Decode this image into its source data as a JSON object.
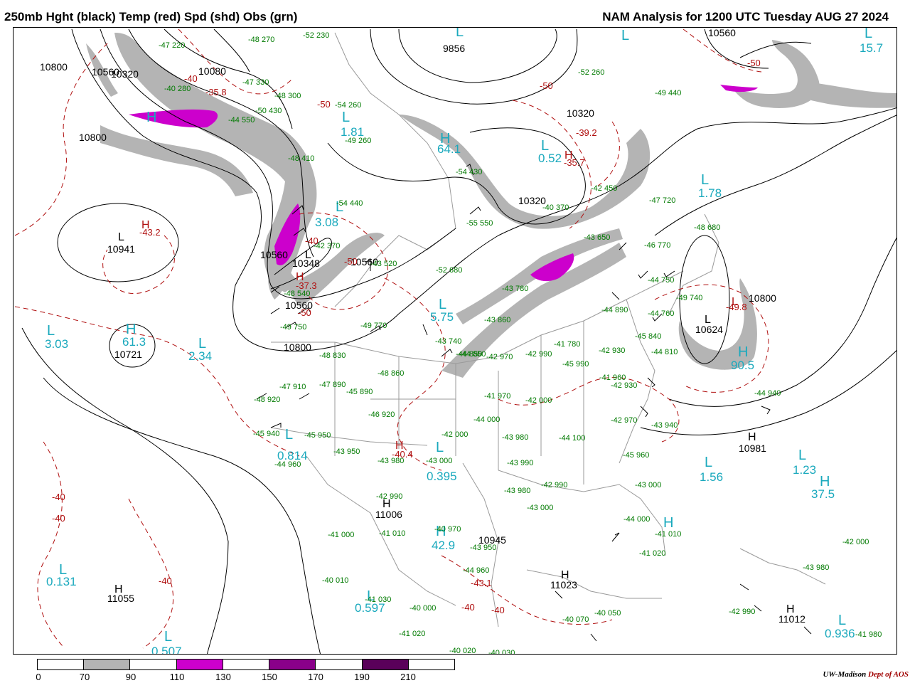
{
  "header": {
    "title_left": "250mb Hght (black) Temp (red) Spd (shd) Obs (grn)",
    "title_right": "NAM Analysis for 1200 UTC Tuesday  AUG 27 2024"
  },
  "legend": {
    "ticks": [
      "0",
      "70",
      "90",
      "110",
      "130",
      "150",
      "170",
      "190",
      "210"
    ],
    "colors": [
      "#ffffff",
      "#b4b4b4",
      "#ffffff",
      "#cc00cc",
      "#ffffff",
      "#8a008a",
      "#ffffff",
      "#5a005a"
    ]
  },
  "credit": {
    "org": "UW-Madison",
    "dept": "Dept of AOS"
  },
  "colors": {
    "height": "#000000",
    "temp": "#b01010",
    "speed_shade": "#b4b4b4",
    "jet_core": "#cc00cc",
    "obs": "#007a00",
    "center_values": "#1aa9bd"
  },
  "height_labels": [
    "10800",
    "10560",
    "10320",
    "10080",
    "10800",
    "9856",
    "10320",
    "10320",
    "10800",
    "10941",
    "10560",
    "10348",
    "10560",
    "10560",
    "10560",
    "10800",
    "10721",
    "10624",
    "10981",
    "11006",
    "10945",
    "11023",
    "11055",
    "11012"
  ],
  "temp_labels": [
    "-43.2",
    "-40",
    "-50",
    "-50",
    "-35.8",
    "-35.7",
    "-39.2",
    "-50",
    "-40",
    "-50",
    "-37.3",
    "-50",
    "-49.8",
    "-40.4",
    "-43.1",
    "-40",
    "-40",
    "-40",
    "-40",
    "-40"
  ],
  "center_values": [
    "0.52",
    "1.81",
    "3.03",
    "3.08",
    "5.75",
    "1.78",
    "0.395",
    "42.9",
    "0.814",
    "2.34",
    "1.56",
    "1.23",
    "37.5",
    "0.131",
    "0.597",
    "0.507",
    "0.936",
    "15.7",
    "64.1",
    "61.3",
    "90.5"
  ],
  "high_low_marks": {
    "high": "H",
    "low": "L"
  },
  "obs_labels": [
    "-47 220",
    "-52 230",
    "-48 270",
    "-40 280",
    "-47 330",
    "-48 300",
    "-50 430",
    "-44 550",
    "-48 410",
    "-54 260",
    "-49 260",
    "-54 440",
    "-42 370",
    "-43 520",
    "-48 540",
    "-49 750",
    "-55 550",
    "-52 680",
    "-43 780",
    "-43 860",
    "-43 740",
    "-44 850",
    "-41 780",
    "-42 970",
    "-41 970",
    "-45 990",
    "-42 990",
    "-42 930",
    "-41 960",
    "-42 930",
    "-44 890",
    "-45 840",
    "-44 810",
    "-44 750",
    "-44 760",
    "-49 740",
    "-46 770",
    "-47 720",
    "-48 680",
    "-42 450",
    "-40 370",
    "-54 430",
    "-52 260",
    "-49 440",
    "-43 650",
    "-44 940",
    "-42 000",
    "-43 980",
    "-43 000",
    "-44 000",
    "-42 000",
    "-44 100",
    "-45 960",
    "-42 970",
    "-43 940",
    "-45 940",
    "-44 960",
    "-48 830",
    "-49 770",
    "-48 860",
    "-47 910",
    "-47 890",
    "-45 890",
    "-48 920",
    "-46 920",
    "-45 950",
    "-43 950",
    "-43 980",
    "-42 990",
    "-41 010",
    "-40 970",
    "-43 980",
    "-43 950",
    "-44 960",
    "-41 030",
    "-40 010",
    "-41 000",
    "-40 000",
    "-41 020",
    "-40 070",
    "-40 050",
    "-40 020",
    "-40 030",
    "-42 990",
    "-43 980",
    "-42 000",
    "-41 980",
    "-41 020",
    "-41 010",
    "-42 990",
    "-43 000",
    "-43 990",
    "-43 000",
    "-44 000",
    "-44 850"
  ]
}
